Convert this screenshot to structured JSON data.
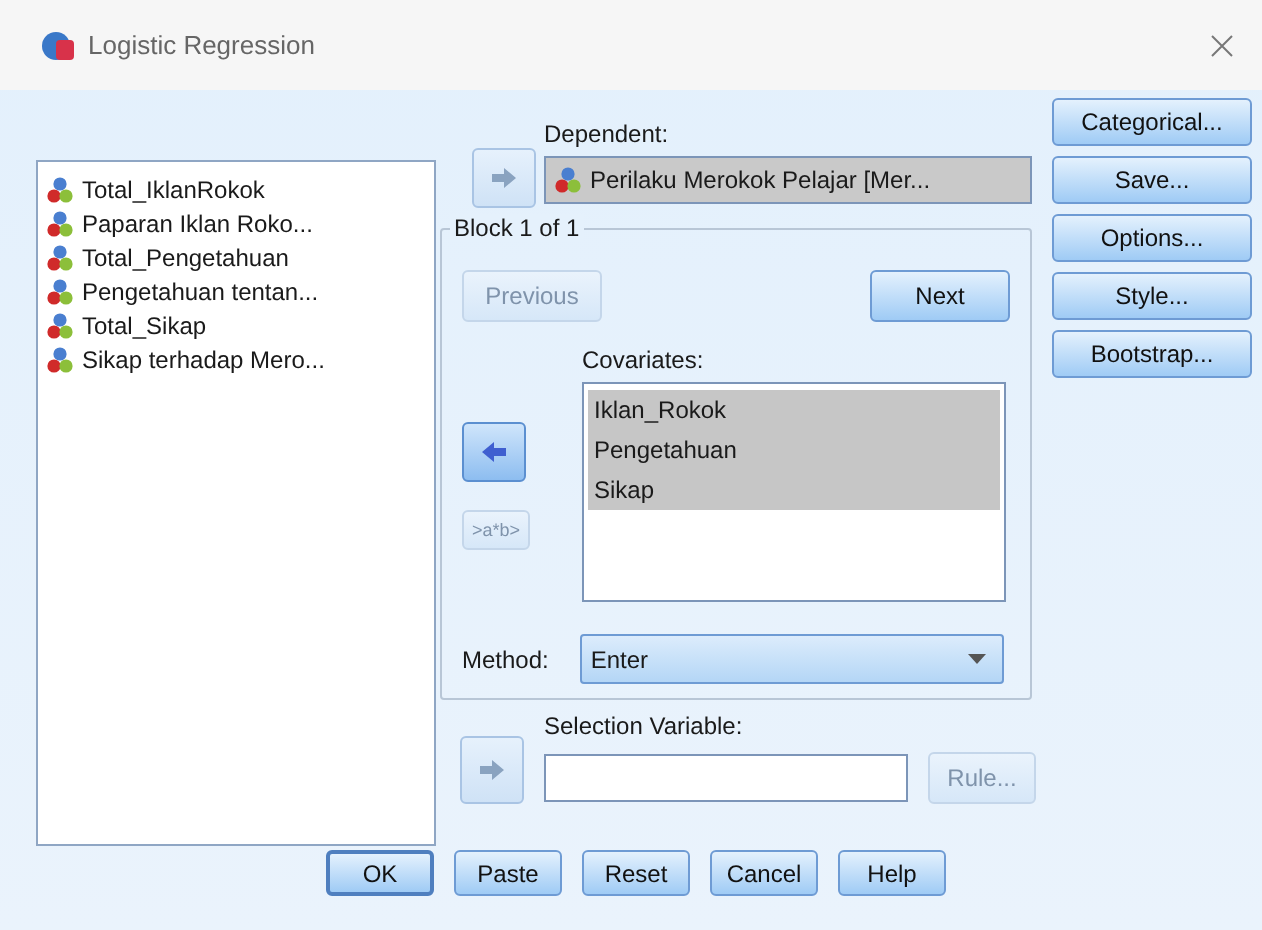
{
  "window": {
    "title": "Logistic Regression"
  },
  "variables": [
    {
      "name": "Total_IklanRokok"
    },
    {
      "name": "Paparan Iklan Roko..."
    },
    {
      "name": "Total_Pengetahuan"
    },
    {
      "name": "Pengetahuan tentan..."
    },
    {
      "name": "Total_Sikap"
    },
    {
      "name": "Sikap terhadap Mero..."
    }
  ],
  "dependent": {
    "label": "Dependent:",
    "value": "Perilaku Merokok Pelajar [Mer...",
    "arrow": {
      "kind": "add",
      "disabled": true
    }
  },
  "block": {
    "title": "Block 1 of 1",
    "previous": {
      "label": "Previous",
      "disabled": true
    },
    "next": {
      "label": "Next",
      "disabled": false
    },
    "covariates_label": "Covariates:",
    "arrow": {
      "kind": "remove",
      "disabled": false
    },
    "covariates": [
      {
        "name": "Iklan_Rokok",
        "selected": true
      },
      {
        "name": "Pengetahuan",
        "selected": true
      },
      {
        "name": "Sikap",
        "selected": true
      }
    ],
    "interaction": {
      "label": ">a*b>",
      "disabled": true
    },
    "method": {
      "label": "Method:",
      "value": "Enter"
    }
  },
  "selection": {
    "label": "Selection Variable:",
    "arrow": {
      "kind": "add",
      "disabled": true
    },
    "rule": {
      "label": "Rule...",
      "disabled": true
    }
  },
  "side_buttons": [
    "Categorical...",
    "Save...",
    "Options...",
    "Style...",
    "Bootstrap..."
  ],
  "footer_buttons": [
    "OK",
    "Paste",
    "Reset",
    "Cancel",
    "Help"
  ]
}
